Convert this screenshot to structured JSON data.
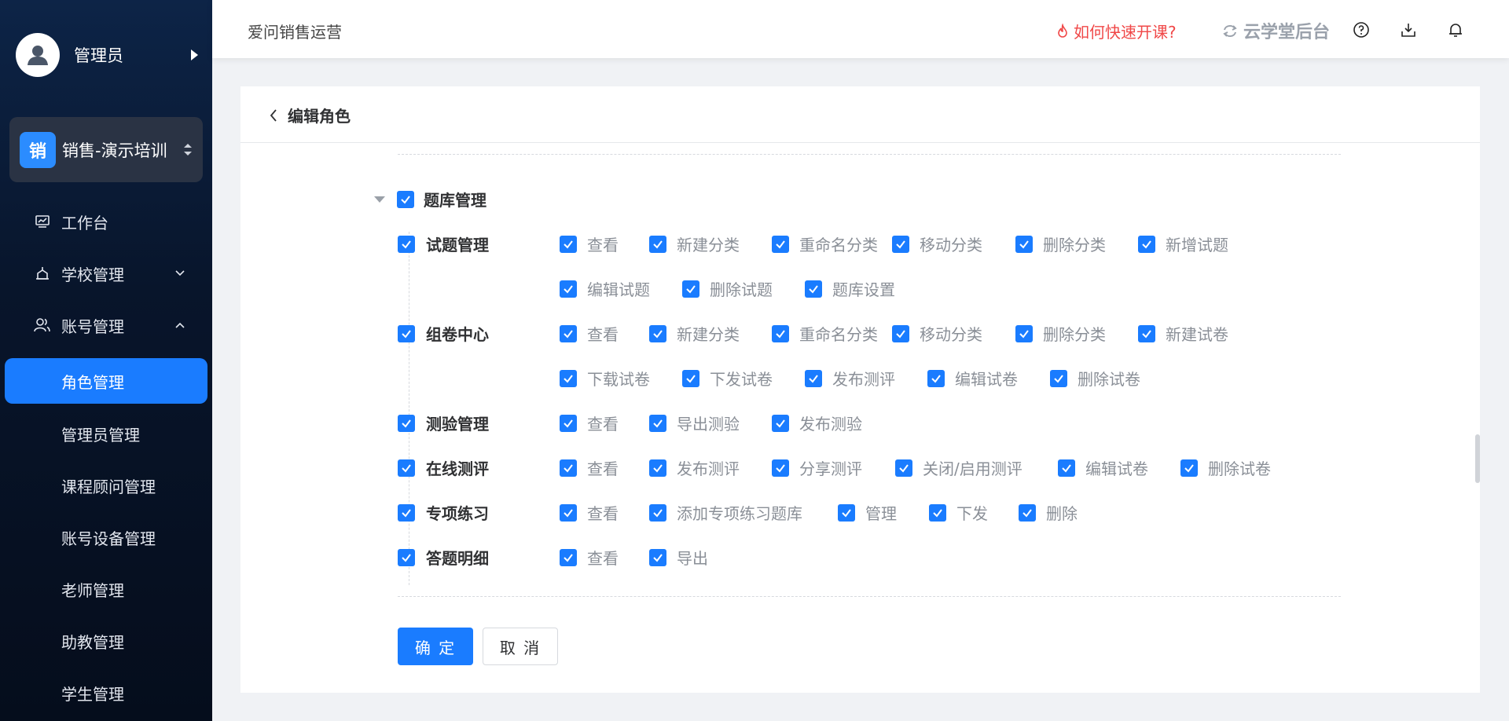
{
  "sidebar": {
    "user_name": "管理员",
    "org_badge": "销",
    "org_name": "销售-演示培训",
    "menu": {
      "workbench": "工作台",
      "school": "学校管理",
      "account": "账号管理"
    },
    "sub_items": [
      "角色管理",
      "管理员管理",
      "课程顾问管理",
      "账号设备管理",
      "老师管理",
      "助教管理",
      "学生管理"
    ],
    "active_sub": "角色管理"
  },
  "header": {
    "title": "爱问销售运营",
    "help_link": "如何快速开课?",
    "cloud_link": "云学堂后台"
  },
  "page": {
    "back_title": "编辑角色",
    "section_label": "题库管理",
    "rows": [
      {
        "label": "试题管理",
        "perms": [
          "查看",
          "新建分类",
          "重命名分类",
          "移动分类",
          "删除分类",
          "新增试题",
          "编辑试题",
          "删除试题",
          "题库设置"
        ]
      },
      {
        "label": "组卷中心",
        "perms": [
          "查看",
          "新建分类",
          "重命名分类",
          "移动分类",
          "删除分类",
          "新建试卷",
          "下载试卷",
          "下发试卷",
          "发布测评",
          "编辑试卷",
          "删除试卷"
        ]
      },
      {
        "label": "测验管理",
        "perms": [
          "查看",
          "导出测验",
          "发布测验"
        ]
      },
      {
        "label": "在线测评",
        "perms": [
          "查看",
          "发布测评",
          "分享测评",
          "关闭/启用测评",
          "编辑试卷",
          "删除试卷"
        ]
      },
      {
        "label": "专项练习",
        "perms": [
          "查看",
          "添加专项练习题库",
          "管理",
          "下发",
          "删除"
        ]
      },
      {
        "label": "答题明细",
        "perms": [
          "查看",
          "导出"
        ]
      }
    ],
    "confirm_label": "确 定",
    "cancel_label": "取 消"
  },
  "colors": {
    "primary": "#1a7cff",
    "danger": "#f04848",
    "sidebar_bg": "#08152b"
  }
}
